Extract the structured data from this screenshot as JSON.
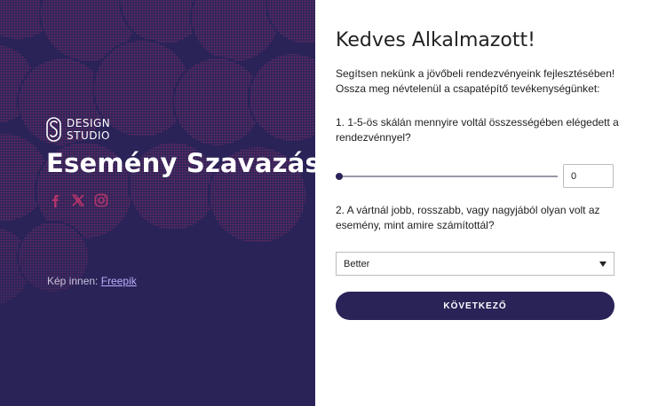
{
  "left_panel": {
    "brand": {
      "line1": "DESIGN",
      "line2": "STUDIO"
    },
    "title": "Esemény Szavazás",
    "social": [
      "facebook-icon",
      "x-icon",
      "instagram-icon"
    ],
    "credit_prefix": "Kép innen:",
    "credit_link": "Freepik",
    "colors": {
      "background": "#2a2358",
      "circle_accent": "#b0346a"
    }
  },
  "form": {
    "greeting": "Kedves Alkalmazott!",
    "intro": "Segítsen nekünk a jövőbeli rendezvényeink fejlesztésében! Ossza meg névtelenül a csapatépítő tevékenységünket:",
    "q1": {
      "label": "1. 1-5-ös skálán mennyire voltál összességében elégedett a rendezvénnyel?",
      "value": "0"
    },
    "q2": {
      "label": "2. A vártnál jobb, rosszabb, vagy nagyjából olyan volt az esemény, mint amire számítottál?",
      "selected": "Better"
    },
    "next_button": "KÖVETKEZŐ"
  }
}
